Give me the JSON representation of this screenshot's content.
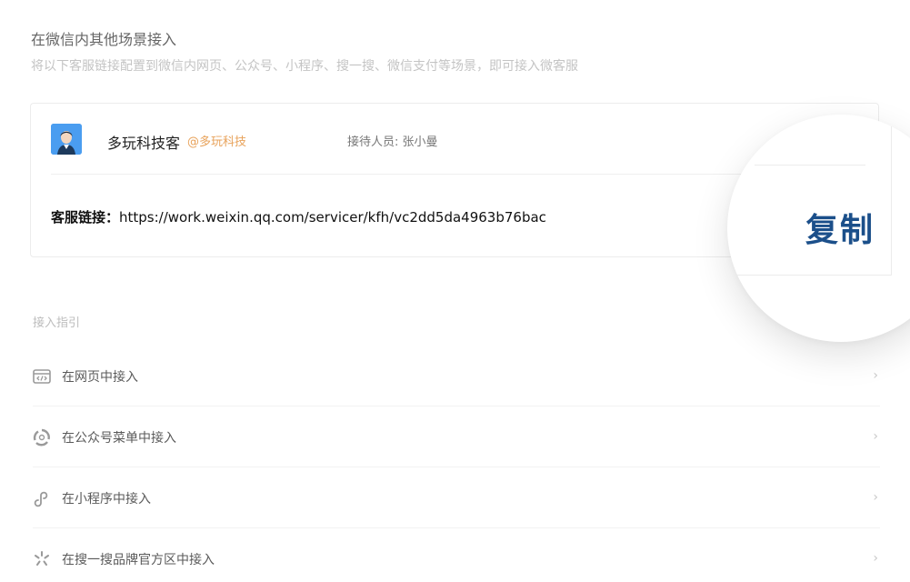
{
  "header": {
    "title": "在微信内其他场景接入",
    "subtitle": "将以下客服链接配置到微信内网页、公众号、小程序、搜一搜、微信支付等场景，即可接入微客服"
  },
  "card": {
    "avatar_icon": "user-avatar-icon",
    "name": "多玩科技客",
    "corp": "@多玩科技",
    "staff": "接待人员: 张小曼",
    "link_label": "客服链接：",
    "link_url": "https://work.weixin.qq.com/servicer/kfh/vc2dd5da4963b76bac",
    "copy_label": "复制"
  },
  "guide": {
    "title": "接入指引",
    "items": [
      {
        "label": "在网页中接入",
        "icon": "web-code-icon"
      },
      {
        "label": "在公众号菜单中接入",
        "icon": "official-account-icon"
      },
      {
        "label": "在小程序中接入",
        "icon": "mini-program-icon"
      },
      {
        "label": "在搜一搜品牌官方区中接入",
        "icon": "search-sparkle-icon"
      }
    ]
  },
  "colors": {
    "accent_copy": "#1b4f8a",
    "corp_tag": "#e8a25a",
    "avatar_bg": "#4a9df0"
  }
}
